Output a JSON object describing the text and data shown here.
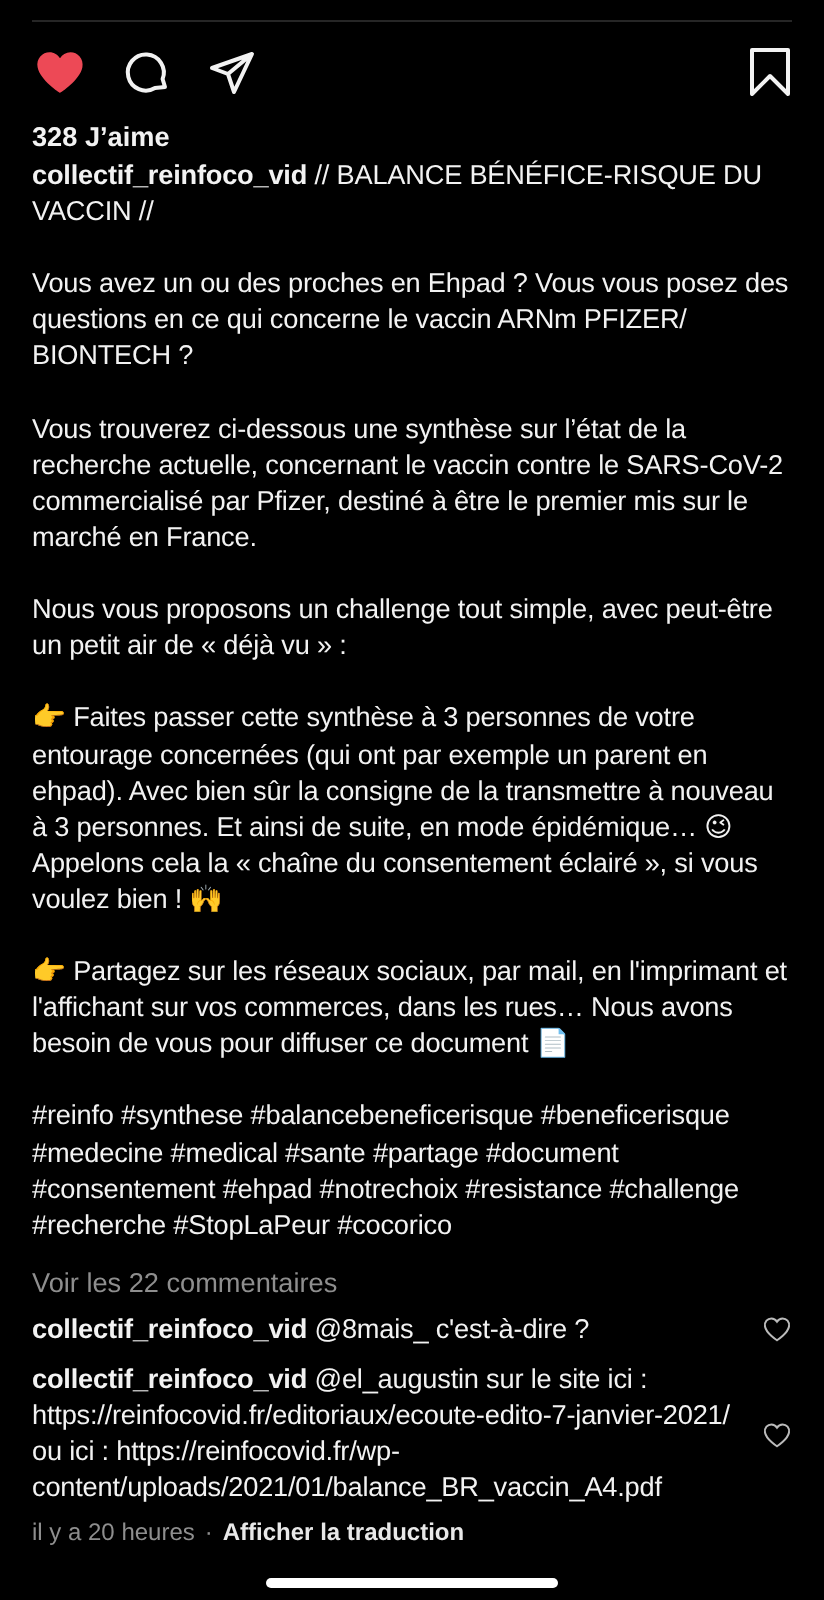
{
  "actions": {
    "liked": true,
    "saved": false
  },
  "likes": "328 J’aime",
  "caption": {
    "username": "collectif_reinfoco_vid",
    "title": "// BALANCE BÉNÉFICE-RISQUE DU VACCIN //",
    "paragraphs": [
      "Vous avez un ou des proches en Ehpad ? Vous vous posez des questions en ce qui concerne le vaccin ARNm PFIZER/ BIONTECH ?",
      "Vous trouverez ci-dessous une synthèse sur l’état de la recherche actuelle, concernant le vaccin contre le SARS-CoV-2 commercialisé par Pfizer, destiné à être le premier mis sur le marché en France.",
      "Nous vous proposons un challenge tout simple, avec peut-être un petit air de « déjà vu » :",
      "👉 Faites passer cette synthèse à 3 personnes de votre entourage concernées (qui ont par exemple un parent en ehpad). Avec bien sûr la consigne de la transmettre à nouveau à 3 personnes. Et ainsi de suite, en mode épidémique… 😉\nAppelons cela la « chaîne du consentement éclairé », si vous voulez bien ! 🙌",
      "👉 Partagez sur les réseaux sociaux, par mail, en l'imprimant et l'affichant sur vos commerces, dans les rues… Nous avons besoin de vous pour diffuser ce document 📄",
      "#reinfo #synthese #balancebeneficerisque #beneficerisque #medecine #medical #sante #partage #document #consentement #ehpad #notrechoix #resistance #challenge #recherche #StopLaPeur #cocorico"
    ]
  },
  "view_comments": "Voir les 22 commentaires",
  "comments": [
    {
      "username": "collectif_reinfoco_vid",
      "text": "@8mais_ c'est-à-dire ?",
      "liked": false
    },
    {
      "username": "collectif_reinfoco_vid",
      "text": "@el_augustin sur le site ici : https://reinfocovid.fr/editoriaux/ecoute-edito-7-janvier-2021/ ou ici : https://reinfocovid.fr/wp-content/uploads/2021/01/balance_BR_vaccin_A4.pdf",
      "liked": false
    }
  ],
  "footer": {
    "time": "il y a 20 heures",
    "separator": "·",
    "translate": "Afficher la traduction"
  }
}
